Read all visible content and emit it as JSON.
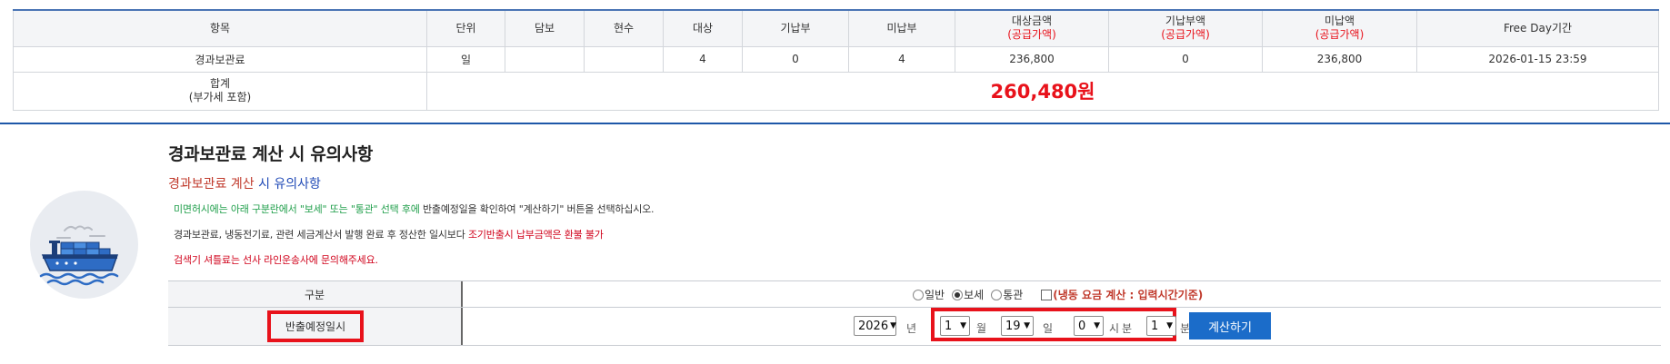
{
  "fee_table": {
    "headers": [
      {
        "line1": "항목",
        "line2": ""
      },
      {
        "line1": "단위",
        "line2": ""
      },
      {
        "line1": "담보",
        "line2": ""
      },
      {
        "line1": "현수",
        "line2": ""
      },
      {
        "line1": "대상",
        "line2": ""
      },
      {
        "line1": "기납부",
        "line2": ""
      },
      {
        "line1": "미납부",
        "line2": ""
      },
      {
        "line1": "대상금액",
        "line2": "(공급가액)"
      },
      {
        "line1": "기납부액",
        "line2": "(공급가액)"
      },
      {
        "line1": "미납액",
        "line2": "(공급가액)"
      },
      {
        "line1": "Free Day기간",
        "line2": ""
      }
    ],
    "row": [
      "경과보관료",
      "일",
      "",
      "",
      "4",
      "0",
      "4",
      "236,800",
      "0",
      "236,800",
      "2026-01-15 23:59"
    ],
    "total_label_line1": "합계",
    "total_label_line2": "(부가세 포함)",
    "total_amount": "260,480원"
  },
  "notice": {
    "title": "경과보관료 계산 시 유의사항",
    "subtitle_part1": "경과보관료 계산",
    "subtitle_part2": " 시 유의사항",
    "line1_green": "미면허시에는 아래 구분란에서 \"보세\" 또는 \"통관\" 선택 후에",
    "line1_rest": " 반출예정일을 확인하여 \"계산하기\" 버튼을 선택하십시오.",
    "line2_black": "경과보관료, 냉동전기료, 관련 세금계산서 발행 완료 후 정산한 일시보다 ",
    "line2_red": "조기반출시 납부금액은 환불 불가",
    "line3_red": "검색기 셔틀료는 선사 라인운송사에 문의해주세요."
  },
  "form": {
    "category_label": "구분",
    "radio_options": [
      {
        "label": "일반",
        "checked": false
      },
      {
        "label": "보세",
        "checked": true
      },
      {
        "label": "통관",
        "checked": false
      }
    ],
    "checkbox_label": "(냉동 요금 계산 : 입력시간기준)",
    "date_label": "반출예정일시",
    "year": "2026",
    "year_unit": "년",
    "month": "1",
    "month_unit": "월",
    "day": "19",
    "day_unit": "일",
    "hour": "0",
    "hour_unit": "시",
    "hour_unit2": "분",
    "minute": "1",
    "minute_unit": "분",
    "calc_button": "계산하기"
  },
  "colors": {
    "accent_blue": "#1b6cc9",
    "alert_red": "#e8121b",
    "notice_green": "#1f9e4a",
    "header_border": "#4a74b4"
  },
  "icons": {
    "ship": "cargo-ship-icon",
    "select_arrow": "chevron-down-icon"
  }
}
